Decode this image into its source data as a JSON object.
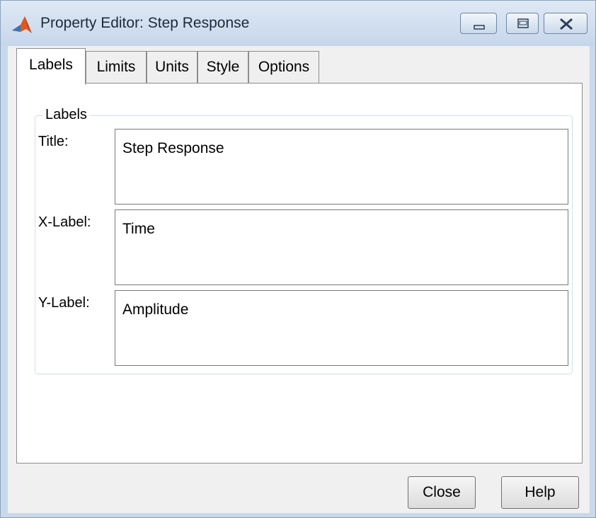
{
  "window": {
    "title": "Property Editor: Step Response",
    "app_icon": "matlab-logo-icon",
    "controls": [
      "minimize-icon",
      "maximize-icon",
      "close-icon"
    ]
  },
  "tabs": [
    {
      "label": "Labels",
      "active": true
    },
    {
      "label": "Limits",
      "active": false
    },
    {
      "label": "Units",
      "active": false
    },
    {
      "label": "Style",
      "active": false
    },
    {
      "label": "Options",
      "active": false
    }
  ],
  "labels_group": {
    "title": "Labels",
    "fields": [
      {
        "label": "Title:",
        "value": "Step Response"
      },
      {
        "label": "X-Label:",
        "value": "Time"
      },
      {
        "label": "Y-Label:",
        "value": "Amplitude"
      }
    ]
  },
  "buttons": {
    "close": "Close",
    "help": "Help"
  },
  "colors": {
    "titlebar": "#c6d6ea",
    "panel": "#ffffff",
    "client": "#f0f0f0"
  }
}
